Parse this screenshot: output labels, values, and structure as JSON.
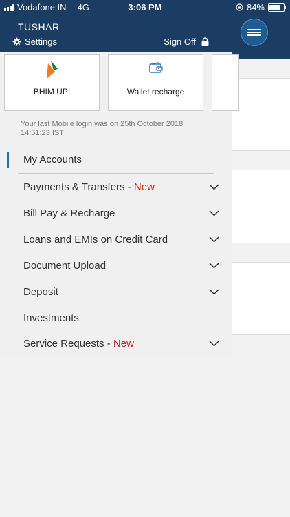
{
  "status_bar": {
    "carrier": "Vodafone IN",
    "network": "4G",
    "time": "3:06 PM",
    "battery": "84%",
    "battery_level": 0.84
  },
  "header": {
    "user_name": "TUSHAR",
    "settings_label": "Settings",
    "sign_off_label": "Sign Off",
    "settings_icon": "gear-icon",
    "sign_off_icon": "lock-icon"
  },
  "quick_actions": [
    {
      "label": "BHIM UPI",
      "icon": "bhim-logo"
    },
    {
      "label": "Wallet recharge",
      "icon": "wallet-icon"
    }
  ],
  "last_login": "Your last Mobile login was on 25th October 2018 14:51:23 IST",
  "menu": {
    "items": [
      {
        "label": "My Accounts"
      },
      {
        "label": "Payments & Transfers",
        "separator": " - ",
        "badge": "New"
      },
      {
        "label": "Bill Pay & Recharge"
      },
      {
        "label": "Loans and EMIs on Credit Card"
      },
      {
        "label": "Document Upload"
      },
      {
        "label": "Deposit"
      },
      {
        "label": "Investments"
      },
      {
        "label": "Service Requests",
        "separator": " - ",
        "badge": "New"
      }
    ]
  },
  "colors": {
    "header_bg": "#1b3d63",
    "accent_blue": "#1f6fb2",
    "new_badge": "#cc1f1f"
  }
}
